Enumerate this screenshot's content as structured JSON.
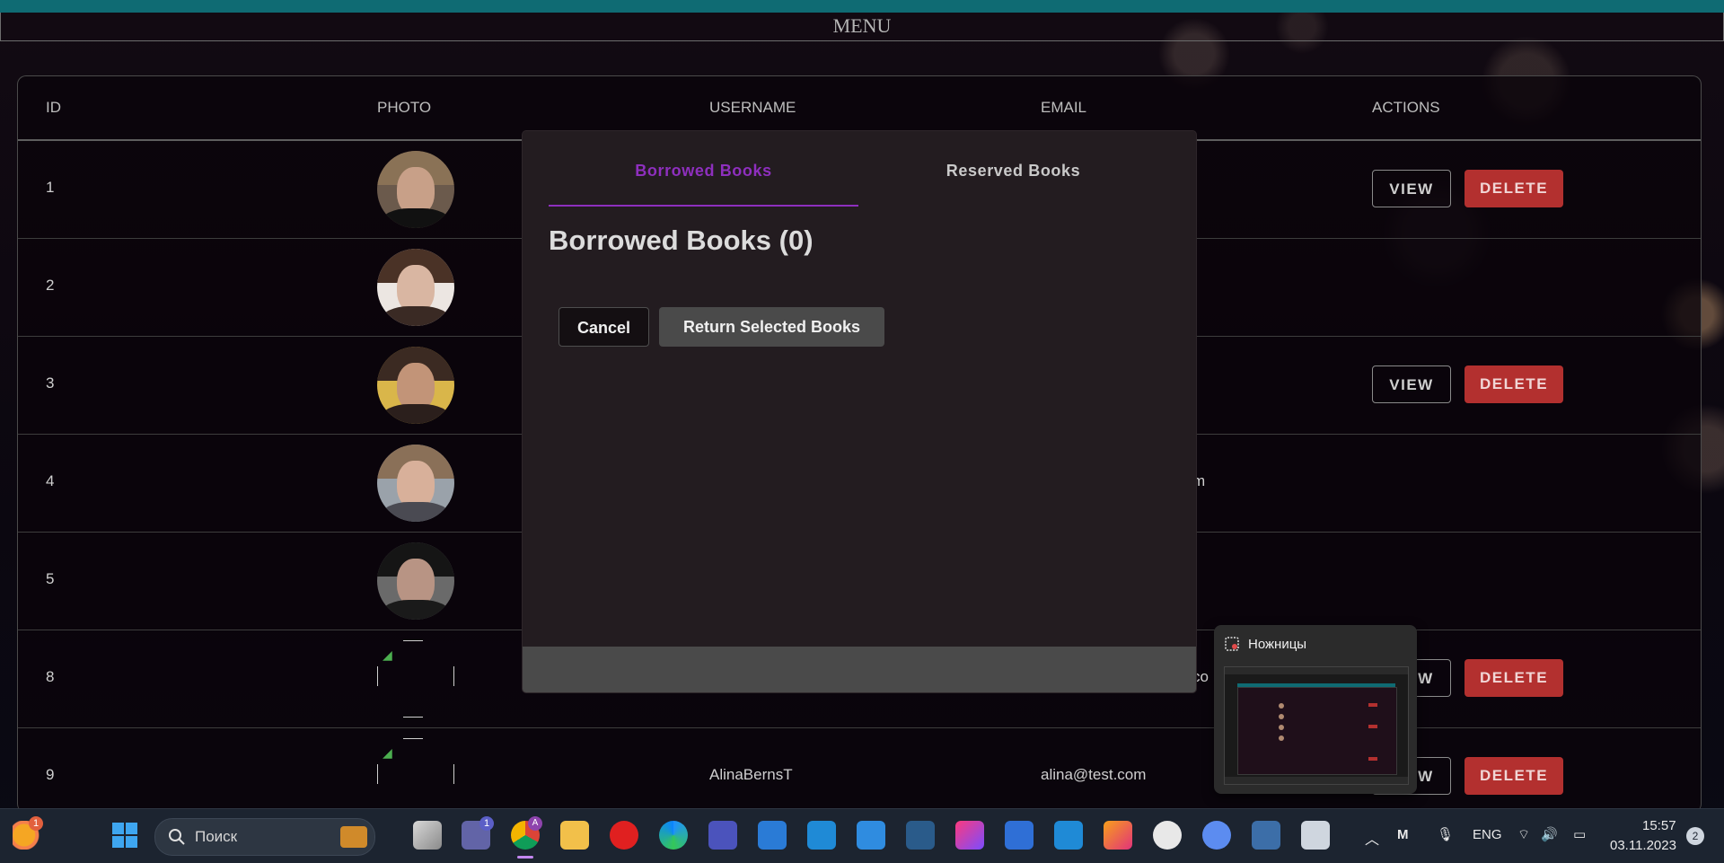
{
  "menu": {
    "title": "MENU"
  },
  "table": {
    "headers": [
      "ID",
      "PHOTO",
      "USERNAME",
      "EMAIL",
      "ACTIONS"
    ],
    "rows": [
      {
        "id": "1",
        "username": "",
        "email": "",
        "has_actions": true
      },
      {
        "id": "2",
        "username": "",
        "email": "",
        "has_actions": false
      },
      {
        "id": "3",
        "username": "",
        "email": "",
        "has_actions": true
      },
      {
        "id": "4",
        "username": "",
        "email": "m",
        "has_actions": false
      },
      {
        "id": "5",
        "username": "",
        "email": "",
        "has_actions": false
      },
      {
        "id": "8",
        "username": "",
        "email": "co",
        "has_actions": true
      },
      {
        "id": "9",
        "username": "AlinaBernsT",
        "email": "alina@test.com",
        "has_actions": true
      }
    ],
    "view_label": "VIEW",
    "delete_label": "DELETE"
  },
  "modal": {
    "tabs": [
      {
        "label": "Borrowed Books",
        "active": true
      },
      {
        "label": "Reserved Books",
        "active": false
      }
    ],
    "heading": "Borrowed Books (0)",
    "cancel_label": "Cancel",
    "return_label": "Return Selected Books"
  },
  "snipping_preview": {
    "title": "Ножницы"
  },
  "taskbar": {
    "search_placeholder": "Поиск",
    "weather_badge": "1",
    "teams_badge": "1",
    "chrome_badge": "A",
    "language": "ENG",
    "time": "15:57",
    "date": "03.11.2023",
    "notification_count": "2"
  },
  "colors": {
    "accent_purple": "#8e2fbe",
    "delete_red": "#b3302f",
    "top_bar_teal": "#0f6b73",
    "modal_bg": "#231c20"
  }
}
